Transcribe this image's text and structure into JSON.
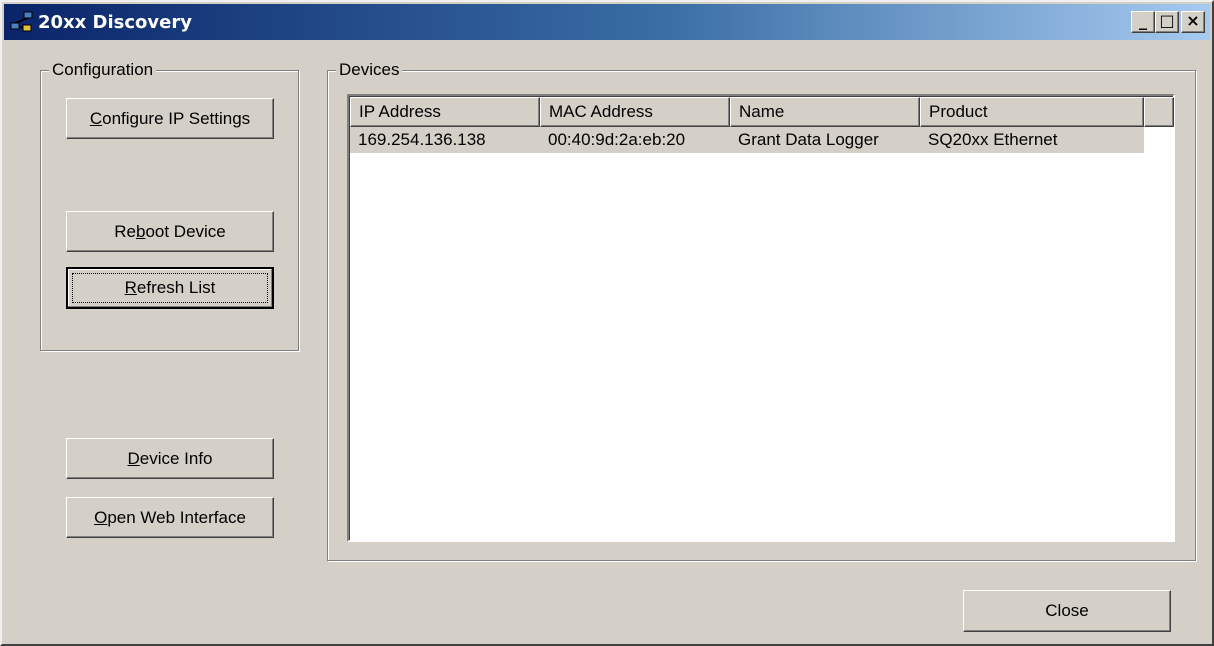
{
  "window": {
    "title": "20xx Discovery",
    "controls": {
      "minimize": "_",
      "maximize": "□",
      "close": "×"
    }
  },
  "configuration": {
    "label": "Configuration",
    "buttons": {
      "configure_ip": {
        "pre": "",
        "key": "C",
        "post": "onfigure IP Settings"
      },
      "reboot": {
        "pre": "Re",
        "key": "b",
        "post": "oot Device"
      },
      "refresh": {
        "pre": "",
        "key": "R",
        "post": "efresh List"
      }
    }
  },
  "actions": {
    "device_info": {
      "pre": "",
      "key": "D",
      "post": "evice Info"
    },
    "open_web": {
      "pre": "",
      "key": "O",
      "post": "pen Web Interface"
    }
  },
  "devices": {
    "label": "Devices",
    "columns": [
      "IP Address",
      "MAC Address",
      "Name",
      "Product"
    ],
    "rows": [
      [
        "169.254.136.138",
        "00:40:9d:2a:eb:20",
        "Grant Data Logger",
        "SQ20xx Ethernet"
      ]
    ]
  },
  "footer": {
    "close_label": "Close"
  },
  "colors": {
    "face": "#d4d0c8",
    "title_start": "#0a246a",
    "title_end": "#a6caf0",
    "selection": "#d4d0c8"
  }
}
